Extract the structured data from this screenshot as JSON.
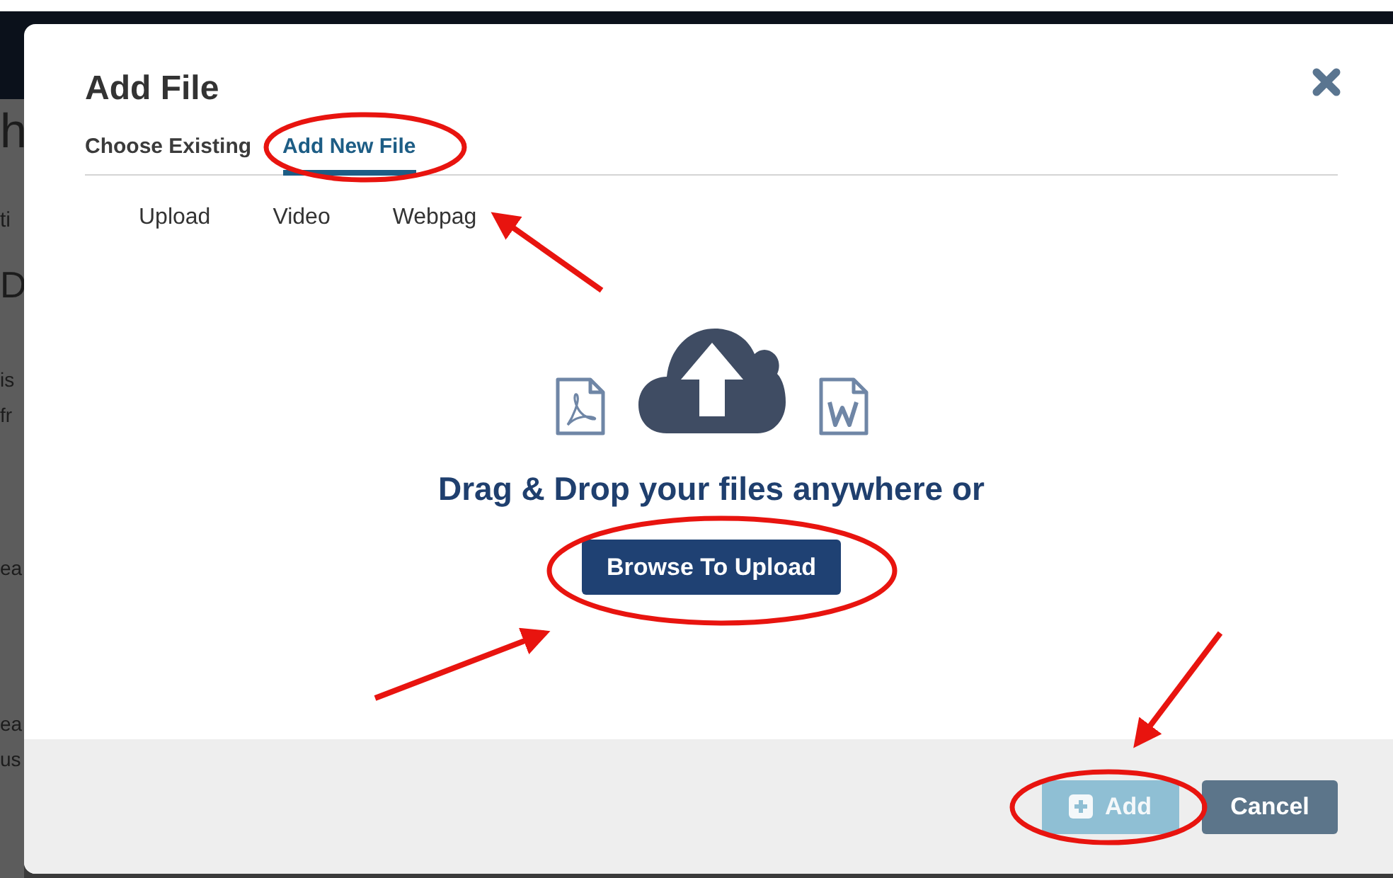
{
  "background_page": {
    "fragments": [
      "h",
      "ti",
      "D",
      "is",
      "fr",
      "ea",
      "ea",
      "us"
    ]
  },
  "dialog": {
    "title": "Add File",
    "tabs": [
      {
        "label": "Choose Existing",
        "selected": false
      },
      {
        "label": "Add New File",
        "selected": true
      }
    ],
    "subtabs": [
      {
        "label": "Upload"
      },
      {
        "label": "Video"
      },
      {
        "label": "Webpag"
      }
    ],
    "drop_zone": {
      "message": "Drag & Drop your files anywhere or",
      "button": "Browse To Upload"
    },
    "footer": {
      "buttons": [
        {
          "label": "Add",
          "kind": "primary",
          "disabled": true
        },
        {
          "label": "Cancel",
          "kind": "secondary",
          "disabled": false
        }
      ]
    }
  }
}
